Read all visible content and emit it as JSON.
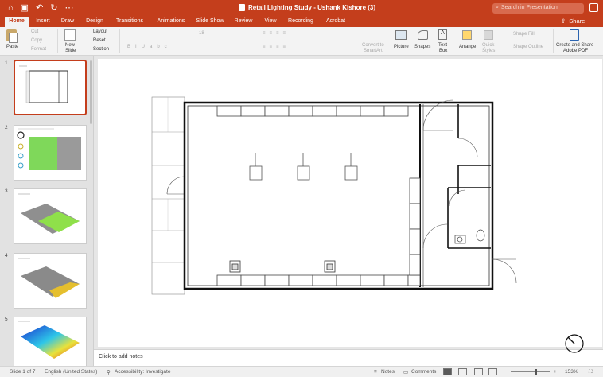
{
  "app": {
    "doc_title": "Retail Lighting Study - Ushank Kishore (3)",
    "search_placeholder": "Search in Presentation",
    "share_label": "Share"
  },
  "tabs": [
    {
      "label": "Home",
      "active": true
    },
    {
      "label": "Insert"
    },
    {
      "label": "Draw"
    },
    {
      "label": "Design"
    },
    {
      "label": "Transitions"
    },
    {
      "label": "Animations"
    },
    {
      "label": "Slide Show"
    },
    {
      "label": "Review"
    },
    {
      "label": "View"
    },
    {
      "label": "Recording"
    },
    {
      "label": "Acrobat"
    }
  ],
  "ribbon": {
    "paste": "Paste",
    "cut": "Cut",
    "copy": "Copy",
    "format": "Format",
    "new_slide_line1": "New",
    "new_slide_line2": "Slide",
    "layout": "Layout",
    "reset": "Reset",
    "section": "Section",
    "font_size": "18",
    "convert_line1": "Convert to",
    "convert_line2": "SmartArt",
    "picture": "Picture",
    "shapes": "Shapes",
    "textbox_line1": "Text",
    "textbox_line2": "Box",
    "arrange": "Arrange",
    "quick_styles_line1": "Quick",
    "quick_styles_line2": "Styles",
    "shape_fill": "Shape Fill",
    "shape_outline": "Shape Outline",
    "adobe_line1": "Create and Share",
    "adobe_line2": "Adobe PDF"
  },
  "slides": [
    {
      "number": "1"
    },
    {
      "number": "2"
    },
    {
      "number": "3"
    },
    {
      "number": "4"
    },
    {
      "number": "5"
    }
  ],
  "notes": {
    "placeholder": "Click to add notes"
  },
  "status": {
    "slide_of": "Slide 1 of 7",
    "language": "English (United States)",
    "accessibility": "Accessibility: Investigate",
    "notes": "Notes",
    "comments": "Comments",
    "zoom": "153%",
    "zoom_fraction": 0.62
  },
  "colors": {
    "accent": "#c43e1c"
  }
}
